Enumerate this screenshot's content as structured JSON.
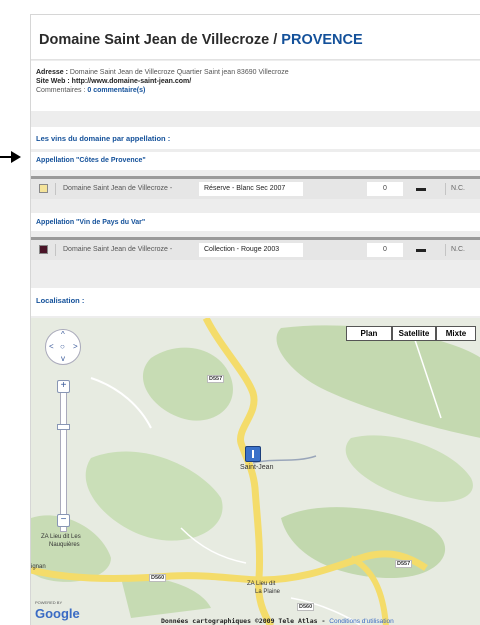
{
  "header": {
    "title": "Domaine Saint Jean de Villecroze / ",
    "region": "PROVENCE"
  },
  "info": {
    "address_label": "Adresse :",
    "address_value": " Domaine Saint Jean de Villecroze Quartier Saint jean 83690 Villecroze",
    "website_label": "Site Web :",
    "website_value": " http://www.domaine-saint-jean.com/",
    "comments_label": "Commentaires :",
    "comments_value": " 0 commentaire(s)"
  },
  "wines_section_title": "Les vins du domaine par appellation :",
  "appellations": [
    {
      "title": "Appellation \"Côtes de Provence\"",
      "wines": [
        {
          "domain": "Domaine Saint Jean de Villecroze -",
          "cuvee": "Réserve - Blanc Sec 2007",
          "score": "0",
          "price": "N.C.",
          "swatch_color": "#f4e39a"
        }
      ]
    },
    {
      "title": "Appellation \"Vin de Pays du Var\"",
      "wines": [
        {
          "domain": "Domaine Saint Jean de Villecroze -",
          "cuvee": "Collection - Rouge 2003",
          "score": "0",
          "price": "N.C.",
          "swatch_color": "#4a1428"
        }
      ]
    }
  ],
  "location_title": "Localisation :",
  "map": {
    "types": [
      "Plan",
      "Satellite",
      "Mixte"
    ],
    "nav": {
      "up": "^",
      "left": "<",
      "right": ">",
      "down": "v",
      "center": "○"
    },
    "zoom_in": "+",
    "zoom_out": "−",
    "marker_label": "Saint-Jean",
    "places": {
      "za1": "ZA Lieu dit Les",
      "za1b": "Nauquières",
      "za2": "ZA Lieu dit",
      "za2b": "La Plaine",
      "ignan": "ignan"
    },
    "roads": {
      "d557a": "D557",
      "d557b": "D557",
      "d560a": "D560",
      "d560b": "D560"
    },
    "google": "Google",
    "powered_by": "POWERED BY",
    "credit": "Données cartographiques ©2009 Tele Atlas - ",
    "terms": "Conditions d'utilisation"
  }
}
